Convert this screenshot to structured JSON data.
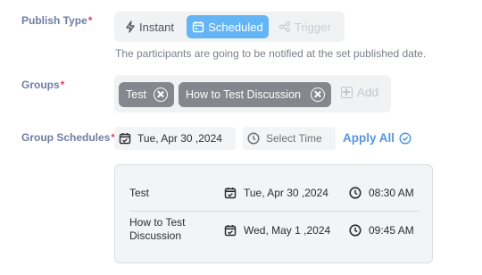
{
  "publish_type": {
    "label": "Publish Type",
    "required_mark": "*",
    "options": [
      {
        "label": "Instant",
        "icon": "lightning-icon",
        "selected": false,
        "disabled": false
      },
      {
        "label": "Scheduled",
        "icon": "calendar-icon",
        "selected": true,
        "disabled": false
      },
      {
        "label": "Trigger",
        "icon": "share-icon",
        "selected": false,
        "disabled": true
      }
    ],
    "hint": "The participants are going to be notified at the set published date."
  },
  "groups": {
    "label": "Groups",
    "required_mark": "*",
    "chips": [
      "Test",
      "How to Test Discussion"
    ],
    "add_label": "Add"
  },
  "group_schedules": {
    "label": "Group Schedules",
    "required_mark": "*",
    "date_value": "Tue, Apr 30 ,2024",
    "time_placeholder": "Select Time",
    "apply_label": "Apply All",
    "rows": [
      {
        "group": "Test",
        "date": "Tue, Apr 30 ,2024",
        "time": "08:30 AM"
      },
      {
        "group": "How to Test Discussion",
        "date": "Wed, May 1 ,2024",
        "time": "09:45 AM"
      }
    ]
  },
  "colors": {
    "accent": "#64b5f6",
    "link": "#5596e0",
    "label": "#6f7da3",
    "required": "#e0455c",
    "chip": "#86868d"
  }
}
